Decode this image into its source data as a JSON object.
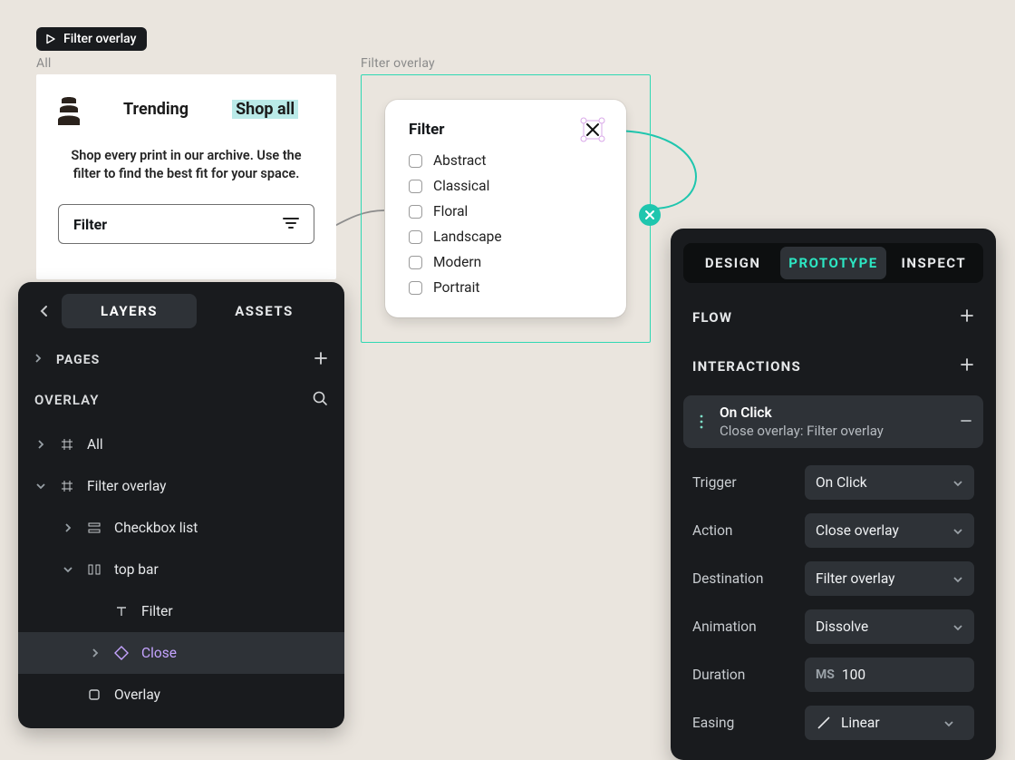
{
  "toolbar": {
    "title": "Filter overlay"
  },
  "canvas": {
    "all_label": "All",
    "overlay_label": "Filter overlay",
    "frame_all": {
      "nav_trending": "Trending",
      "nav_shopall": "Shop all",
      "description": "Shop every print in our archive. Use the filter to find the best fit for your space.",
      "filter_label": "Filter"
    },
    "overlay_frame": {
      "title": "Filter",
      "options": [
        "Abstract",
        "Classical",
        "Floral",
        "Landscape",
        "Modern",
        "Portrait"
      ]
    }
  },
  "left_panel": {
    "tabs": {
      "layers": "LAYERS",
      "assets": "ASSETS"
    },
    "pages": "PAGES",
    "title": "OVERLAY",
    "tree": {
      "all": "All",
      "filter_overlay": "Filter overlay",
      "checkbox_list": "Checkbox list",
      "top_bar": "top bar",
      "filter_text": "Filter",
      "close": "Close",
      "overlay": "Overlay"
    }
  },
  "right_panel": {
    "tabs": {
      "design": "DESIGN",
      "prototype": "PROTOTYPE",
      "inspect": "INSPECT"
    },
    "flow": "FLOW",
    "interactions": "INTERACTIONS",
    "interaction_item": {
      "title": "On Click",
      "subtitle": "Close overlay: Filter overlay"
    },
    "labels": {
      "trigger": "Trigger",
      "action": "Action",
      "destination": "Destination",
      "animation": "Animation",
      "duration": "Duration",
      "easing": "Easing"
    },
    "values": {
      "trigger": "On Click",
      "action": "Close overlay",
      "destination": "Filter overlay",
      "animation": "Dissolve",
      "duration_prefix": "MS",
      "duration": "100",
      "easing": "Linear"
    }
  }
}
